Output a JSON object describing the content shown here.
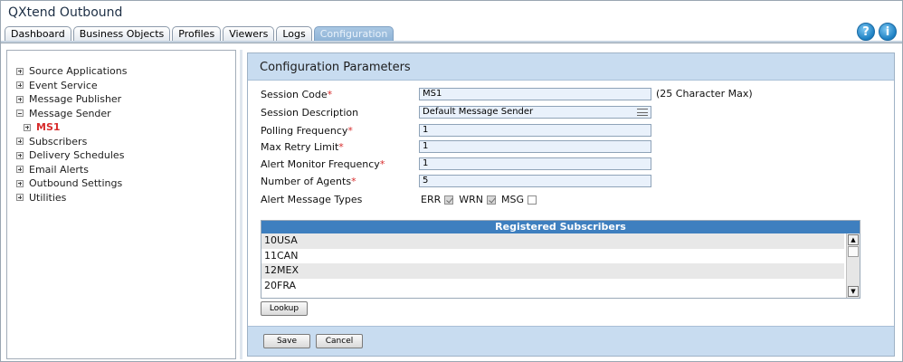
{
  "app": {
    "title": "QXtend Outbound"
  },
  "tabs": [
    {
      "label": "Dashboard"
    },
    {
      "label": "Business Objects"
    },
    {
      "label": "Profiles"
    },
    {
      "label": "Viewers"
    },
    {
      "label": "Logs"
    },
    {
      "label": "Configuration",
      "active": true
    }
  ],
  "header_icons": {
    "help": "?",
    "info": "i"
  },
  "tree": [
    {
      "label": "Source Applications"
    },
    {
      "label": "Event Service"
    },
    {
      "label": "Message Publisher"
    },
    {
      "label": "Message Sender",
      "expanded": true
    },
    {
      "label": "MS1",
      "selected": true
    },
    {
      "label": "Subscribers"
    },
    {
      "label": "Delivery Schedules"
    },
    {
      "label": "Email Alerts"
    },
    {
      "label": "Outbound Settings"
    },
    {
      "label": "Utilities"
    }
  ],
  "panel": {
    "title": "Configuration Parameters"
  },
  "form": {
    "session_code": {
      "label": "Session Code",
      "req": "*",
      "value": "MS1",
      "note": "(25 Character Max)"
    },
    "session_description": {
      "label": "Session Description",
      "value": "Default Message Sender"
    },
    "polling_frequency": {
      "label": "Polling Frequency",
      "req": "*",
      "value": "1"
    },
    "max_retry_limit": {
      "label": "Max Retry Limit",
      "req": "*",
      "value": "1"
    },
    "alert_monitor_frequency": {
      "label": "Alert Monitor Frequency",
      "req": "*",
      "value": "1"
    },
    "number_of_agents": {
      "label": "Number of Agents",
      "req": "*",
      "value": "5"
    },
    "alert_message_types": {
      "label": "Alert Message Types",
      "options": [
        {
          "label": "ERR",
          "checked": true
        },
        {
          "label": "WRN",
          "checked": true
        },
        {
          "label": "MSG",
          "checked": false
        }
      ]
    }
  },
  "subscribers": {
    "header": "Registered Subscribers",
    "rows": [
      "10USA",
      "11CAN",
      "12MEX",
      "20FRA"
    ]
  },
  "buttons": {
    "lookup": "Lookup",
    "save": "Save",
    "cancel": "Cancel"
  },
  "colors": {
    "accent": "#3e7fbf",
    "panel_header": "#c8dcf0",
    "required": "#d72c2c"
  }
}
